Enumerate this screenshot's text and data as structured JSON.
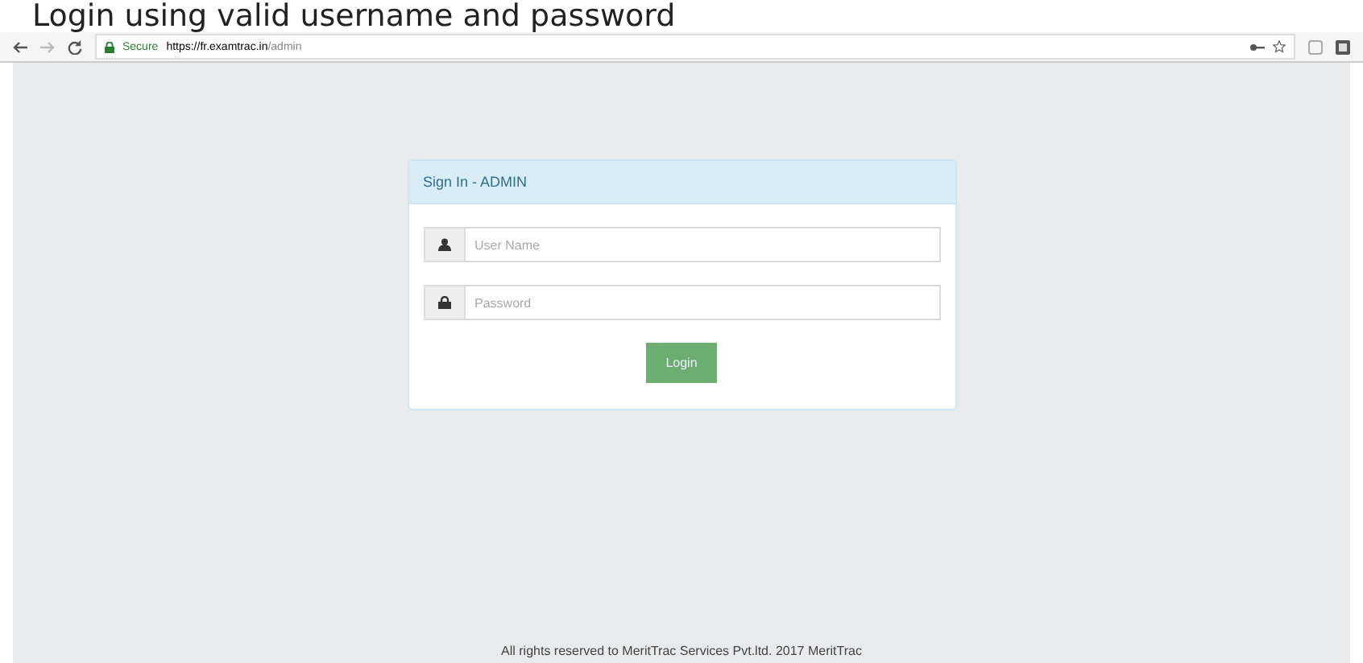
{
  "caption": "Login using valid username and password",
  "browser": {
    "secure_label": "Secure",
    "url_host": "https://fr.examtrac.in",
    "url_path": "/admin"
  },
  "login_panel": {
    "title": "Sign In - ADMIN",
    "username": {
      "placeholder": "User Name"
    },
    "password": {
      "placeholder": "Password"
    },
    "button": "Login"
  },
  "footer": "All rights reserved to MeritTrac Services Pvt.ltd. 2017 MeritTrac"
}
